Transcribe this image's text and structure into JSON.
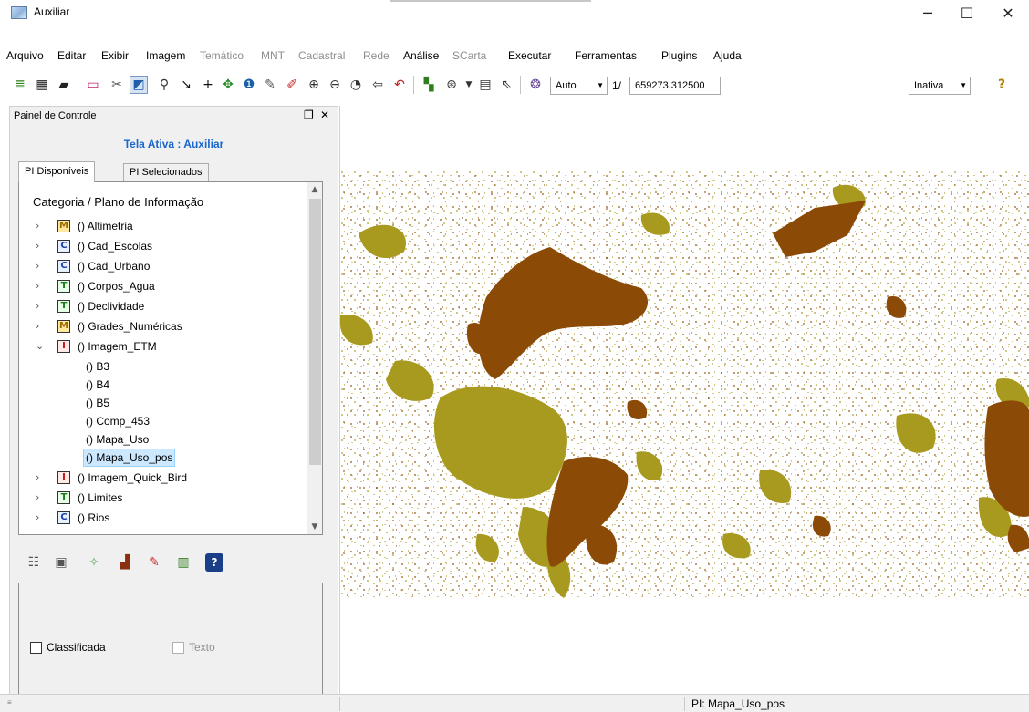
{
  "window": {
    "title": "Auxiliar",
    "minimize": "─",
    "maximize": "☐",
    "close": "✕"
  },
  "menu": [
    "Arquivo",
    "Editar",
    "Exibir",
    "Imagem",
    "Temático",
    "MNT",
    "Cadastral",
    "Rede",
    "Análise",
    "SCarta",
    "Executar",
    "Ferramentas",
    "Plugins",
    "Ajuda"
  ],
  "menu_disabled": [
    "Temático",
    "MNT",
    "Cadastral",
    "Rede",
    "SCarta"
  ],
  "toolbar": {
    "icons": [
      "layers-stack-icon",
      "grid-icon",
      "draw-polygon-icon",
      "rectangle-icon",
      "eraser-icon",
      "select-area-icon",
      "zoom-icon",
      "cursor-arrow-icon",
      "crosshair-icon",
      "pan-icon",
      "info-icon",
      "paint-icon",
      "edit-pencil-icon",
      "zoom-in-icon",
      "zoom-out-icon",
      "zoom-area-icon",
      "back-icon",
      "undo-icon",
      "palette-plugin-icon",
      "zoom-scale-icon",
      "table-icon",
      "pointer-plus-icon",
      "color-icon",
      "help-icon"
    ],
    "zoom_mode": "Auto",
    "scale_prefix": "1/",
    "scale_value": "659273.312500",
    "state": "Inativa",
    "help": "?"
  },
  "panel": {
    "title": "Painel de Controle",
    "float_icon": "❐",
    "close_icon": "✕",
    "active_screen": "Tela Ativa : Auxiliar",
    "tabs": [
      "PI Disponíveis",
      "PI Selecionados"
    ],
    "tree_header": "Categoria / Plano de Informação",
    "categories": [
      {
        "badge": "M",
        "label": "() Altimetria",
        "expanded": false
      },
      {
        "badge": "C",
        "label": "() Cad_Escolas",
        "expanded": false
      },
      {
        "badge": "C",
        "label": "() Cad_Urbano",
        "expanded": false
      },
      {
        "badge": "T",
        "label": "() Corpos_Agua",
        "expanded": false
      },
      {
        "badge": "T",
        "label": "() Declividade",
        "expanded": false
      },
      {
        "badge": "M",
        "label": "() Grades_Numéricas",
        "expanded": false
      },
      {
        "badge": "I",
        "label": "() Imagem_ETM",
        "expanded": true
      }
    ],
    "children": [
      "() B3",
      "() B4",
      "() B5",
      "() Comp_453",
      "() Mapa_Uso",
      "() Mapa_Uso_pos"
    ],
    "more_categories": [
      {
        "badge": "I",
        "label": "() Imagem_Quick_Bird"
      },
      {
        "badge": "T",
        "label": "() Limites"
      },
      {
        "badge": "C",
        "label": "() Rios"
      }
    ],
    "bottom_icons": [
      "list-icon",
      "table-view-icon",
      "magic-wand-icon",
      "chart-icon",
      "pencil-icon",
      "columns-icon",
      "help-book-icon"
    ],
    "checkbox_classified": "Classificada",
    "checkbox_text": "Texto"
  },
  "map": {
    "colors": {
      "class_a": "#8b4a06",
      "class_b": "#a89a1e",
      "background": "#ffffff"
    }
  },
  "status": {
    "pi": "PI: Mapa_Uso_pos"
  }
}
